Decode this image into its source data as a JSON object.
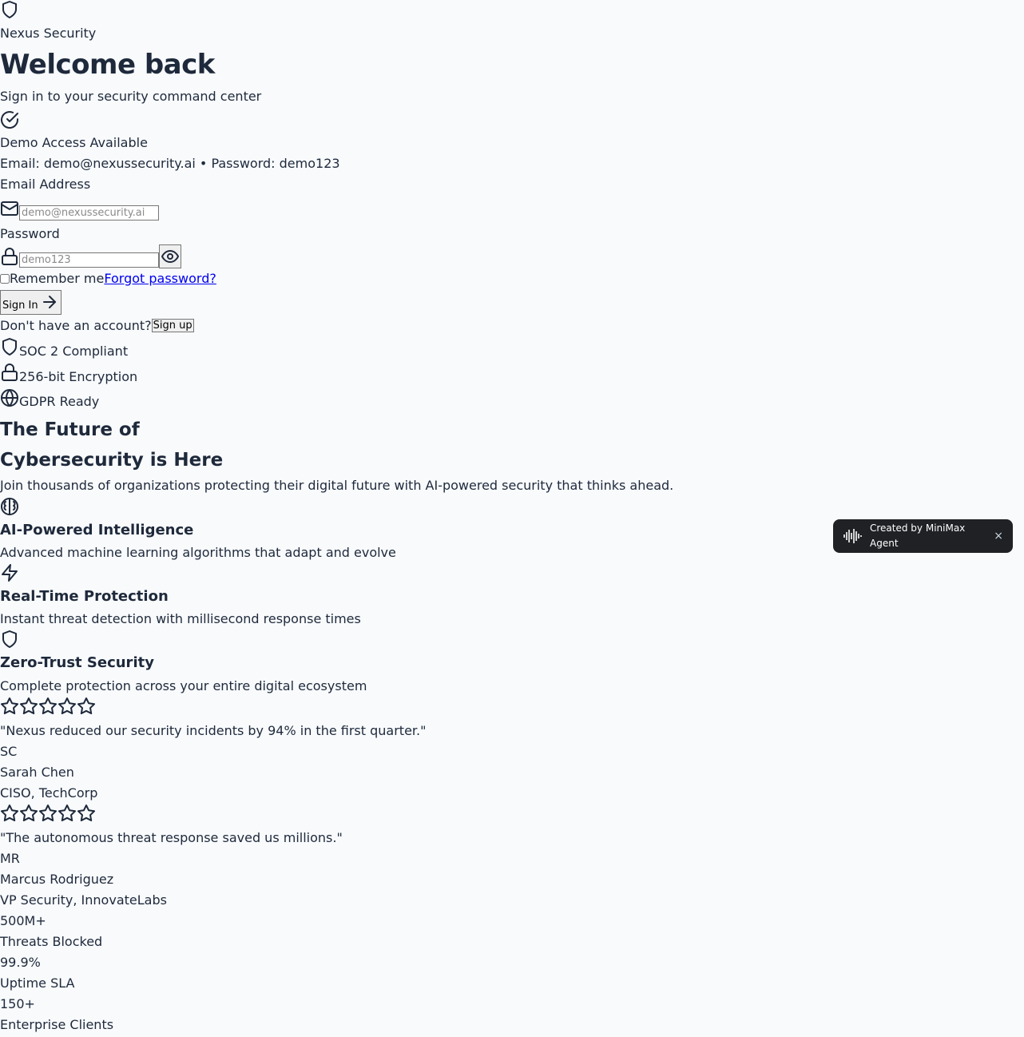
{
  "brand": {
    "name": "Nexus Security",
    "icon": "shield-icon"
  },
  "login": {
    "title": "Welcome back",
    "subtitle": "Sign in to your security command center",
    "demo": {
      "title": "Demo Access Available",
      "credentials": "Email: demo@nexussecurity.ai • Password: demo123"
    },
    "email_label": "Email Address",
    "email_placeholder": "demo@nexussecurity.ai",
    "password_label": "Password",
    "password_placeholder": "demo123",
    "remember_label": "Remember me",
    "forgot_label": "Forgot password?",
    "signin_label": "Sign In",
    "no_account": "Don't have an account?",
    "signup_label": "Sign up"
  },
  "badges": [
    {
      "label": "SOC 2 Compliant",
      "icon": "shield-icon"
    },
    {
      "label": "256-bit Encryption",
      "icon": "lock-icon"
    },
    {
      "label": "GDPR Ready",
      "icon": "globe-icon"
    }
  ],
  "hero": {
    "title_line1": "The Future of",
    "title_line2": "Cybersecurity is Here",
    "description": "Join thousands of organizations protecting their digital future with AI-powered security that thinks ahead."
  },
  "features": [
    {
      "title": "AI-Powered Intelligence",
      "description": "Advanced machine learning algorithms that adapt and evolve",
      "icon": "brain-icon"
    },
    {
      "title": "Real-Time Protection",
      "description": "Instant threat detection with millisecond response times",
      "icon": "zap-icon"
    },
    {
      "title": "Zero-Trust Security",
      "description": "Complete protection across your entire digital ecosystem",
      "icon": "shield-icon"
    }
  ],
  "testimonials": [
    {
      "rating": 5,
      "quote": "\"Nexus reduced our security incidents by 94% in the first quarter.\"",
      "initials": "SC",
      "name": "Sarah Chen",
      "role": "CISO, TechCorp"
    },
    {
      "rating": 5,
      "quote": "\"The autonomous threat response saved us millions.\"",
      "initials": "MR",
      "name": "Marcus Rodriguez",
      "role": "VP Security, InnovateLabs"
    }
  ],
  "stats": [
    {
      "value": "500M+",
      "label": "Threats Blocked"
    },
    {
      "value": "99.9%",
      "label": "Uptime SLA"
    },
    {
      "value": "150+",
      "label": "Enterprise Clients"
    }
  ],
  "toast": {
    "label": "Created by MiniMax Agent",
    "close": "×"
  }
}
